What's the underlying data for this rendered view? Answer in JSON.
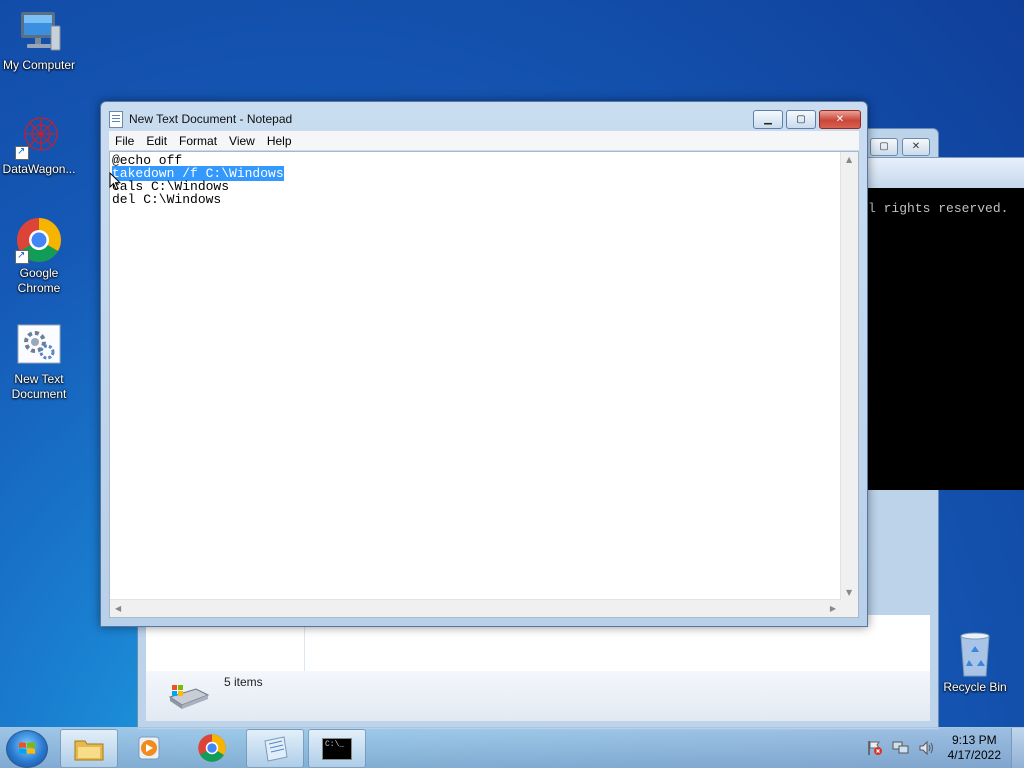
{
  "desktop": {
    "icons": [
      {
        "label": "My Computer"
      },
      {
        "label": "DataWagon..."
      },
      {
        "label": "Google Chrome"
      },
      {
        "label": "New Text Document"
      },
      {
        "label": "Recycle Bin"
      }
    ]
  },
  "explorer": {
    "status_text": "5 items"
  },
  "console": {
    "visible_text": "l rights reserved."
  },
  "notepad": {
    "title": "New Text Document - Notepad",
    "menu": [
      "File",
      "Edit",
      "Format",
      "View",
      "Help"
    ],
    "lines": {
      "line1": "@echo off",
      "line2_selected": "takedown /f C:\\Windows",
      "line3": "cals C:\\Windows",
      "line4": "del C:\\Windows"
    }
  },
  "taskbar": {
    "clock": {
      "time": "9:13 PM",
      "date": "4/17/2022"
    },
    "console_label": "C:\\_"
  },
  "colors": {
    "selection": "#3399ff",
    "close_button": "#c8473a",
    "desktop_blue": "#1559b6"
  }
}
